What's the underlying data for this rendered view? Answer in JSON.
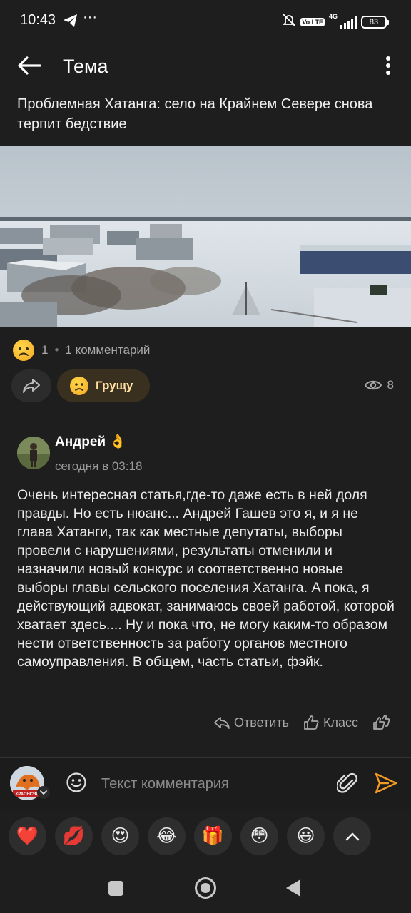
{
  "status_bar": {
    "time": "10:43",
    "dots": "···",
    "network": "4G",
    "volte": "Vo LTE",
    "battery": "83"
  },
  "app_bar": {
    "title": "Тема"
  },
  "article": {
    "title": "Проблемная Хатанга: село на Крайнем Севере снова терпит бедствие"
  },
  "reactions": {
    "count": "1",
    "comments": "1 комментарий",
    "my_reaction_label": "Грущу",
    "views": "8"
  },
  "comment": {
    "author": "Андрей",
    "author_emoji": "👌",
    "time": "сегодня в 03:18",
    "text": "Очень интересная статья,где-то даже есть в ней доля правды. Но есть нюанс... Андрей Гашев это я, и я не глава Хатанги, так как местные депутаты, выборы провели с нарушениями, результаты отменили и назначили новый конкурс и соответственно новые выборы главы сельского поселения Хатанга. А пока, я действующий адвокат, занимаюсь своей работой, которой хватает здесь.... Ну и пока что, не могу каким-то образом нести ответственность за работу органов местного самоуправления. В общем, часть статьи, фэйк.",
    "reply_label": "Ответить",
    "like_label": "Класс"
  },
  "input": {
    "placeholder": "Текст комментария",
    "avatar_text": "КРАСНСЯР"
  },
  "quick_reactions": [
    "❤️",
    "💋",
    "😍",
    "😂",
    "🎁",
    "😳",
    "😃"
  ],
  "colors": {
    "background": "#1e1e1e",
    "accent": "#f59a23",
    "reaction_button": "#3a3020"
  }
}
